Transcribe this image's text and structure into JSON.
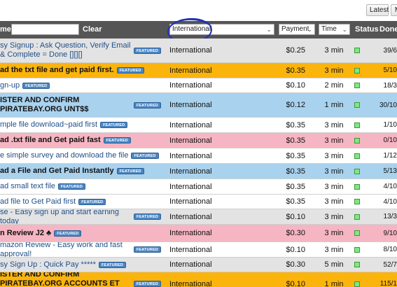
{
  "toolbar": {
    "latest_label": "Latest",
    "more_label": "M"
  },
  "header": {
    "name_label": "me",
    "clear_label": "Clear",
    "country_filter": "International",
    "payment_filter": "Payment",
    "time_filter": "Time",
    "status_label": "Status",
    "done_label": "Done"
  },
  "badge_text": "FEATURED",
  "colors": {
    "grey": "#e3e3e3",
    "white": "#ffffff",
    "orange": "#fbb40c",
    "blue": "#a9d2ee",
    "pink": "#f6b5c2",
    "status_green": "#80e880"
  },
  "rows": [
    {
      "title": "sy Signup : Ask Question, Verify Email & Complete = Done [][][]",
      "bold": false,
      "color": "grey",
      "country": "International",
      "payment": "$0.25",
      "time": "3 min",
      "done": "39/6"
    },
    {
      "title": "ad the txt file and get paid first.",
      "bold": true,
      "color": "orange",
      "country": "International",
      "payment": "$0.35",
      "time": "3 min",
      "done": "5/10"
    },
    {
      "title": "gn-up",
      "bold": false,
      "color": "white",
      "country": "International",
      "payment": "$0.10",
      "time": "2 min",
      "done": "18/3"
    },
    {
      "title": "ISTER AND CONFIRM PIRATEBAY.ORG UNT$$",
      "bold": true,
      "color": "blue",
      "country": "International",
      "payment": "$0.12",
      "time": "1 min",
      "done": "30/10"
    },
    {
      "title": "mple file download~paid first",
      "bold": false,
      "color": "white",
      "country": "International",
      "payment": "$0.35",
      "time": "3 min",
      "done": "1/10"
    },
    {
      "title": "ad .txt file and Get paid fast",
      "bold": true,
      "color": "pink",
      "country": "International",
      "payment": "$0.35",
      "time": "3 min",
      "done": "0/10"
    },
    {
      "title": "e simple survey and download the file",
      "bold": false,
      "color": "white",
      "country": "International",
      "payment": "$0.35",
      "time": "3 min",
      "done": "1/12"
    },
    {
      "title": "ad a File and Get Paid Instantly",
      "bold": true,
      "color": "blue",
      "country": "International",
      "payment": "$0.35",
      "time": "3 min",
      "done": "5/13"
    },
    {
      "title": "ad small text file",
      "bold": false,
      "color": "white",
      "country": "International",
      "payment": "$0.35",
      "time": "3 min",
      "done": "4/10"
    },
    {
      "title": "ad file to Get Paid first",
      "bold": false,
      "color": "white",
      "country": "International",
      "payment": "$0.35",
      "time": "3 min",
      "done": "4/10"
    },
    {
      "title": "se - Easy sign up and start earning today",
      "bold": false,
      "color": "grey",
      "country": "International",
      "payment": "$0.10",
      "time": "3 min",
      "done": "13/3"
    },
    {
      "title": "n Review J2 ♣",
      "bold": true,
      "color": "pink",
      "country": "International",
      "payment": "$0.30",
      "time": "3 min",
      "done": "9/10"
    },
    {
      "title": "mazon Review - Easy work and fast approval!",
      "bold": false,
      "color": "white",
      "country": "International",
      "payment": "$0.10",
      "time": "3 min",
      "done": "8/10"
    },
    {
      "title": "sy Sign Up : Quick Pay *****",
      "bold": false,
      "color": "grey",
      "country": "International",
      "payment": "$0.30",
      "time": "5 min",
      "done": "52/7"
    },
    {
      "title": "ISTER AND CONFIRM PIRATEBAY.ORG ACCOUNTS ET YOUR MONEY<",
      "bold": true,
      "color": "orange",
      "country": "International",
      "payment": "$0.10",
      "time": "1 min",
      "done": "115/1"
    }
  ]
}
